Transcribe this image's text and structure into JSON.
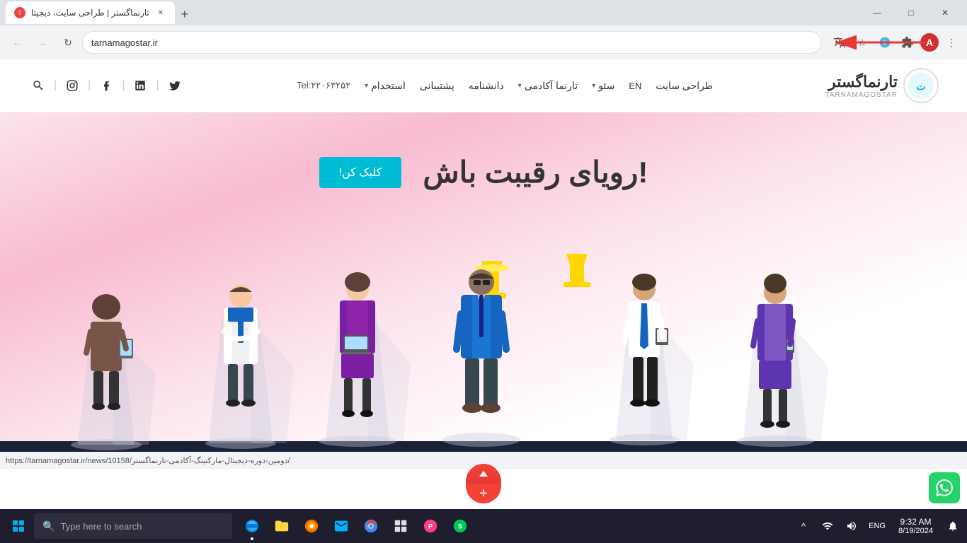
{
  "browser": {
    "tab": {
      "title": "تارنماگستر | طراحی سایت، دیجیتا",
      "favicon": "T"
    },
    "address": "tarnamagostar.ir",
    "new_tab_label": "+",
    "nav": {
      "back_disabled": true,
      "forward_disabled": true
    },
    "window_buttons": {
      "minimize": "—",
      "maximize": "□",
      "close": "✕"
    }
  },
  "site": {
    "logo": {
      "text_fa": "تارنماگستر",
      "text_en": "TARNAMAGOSTAR"
    },
    "nav_items": [
      {
        "label": "طراحی سایت",
        "has_dropdown": false
      },
      {
        "label": "EN",
        "has_dropdown": false
      },
      {
        "label": "سئو",
        "has_dropdown": true
      },
      {
        "label": "تارنما آکادمی",
        "has_dropdown": true
      },
      {
        "label": "دانشنامه",
        "has_dropdown": false
      },
      {
        "label": "پشتیبانی",
        "has_dropdown": false
      },
      {
        "label": "استخدام",
        "has_dropdown": true
      }
    ],
    "tel": "Tel:۲۲۰۶۳۲۵۲",
    "social_icons": [
      "twitter",
      "linkedin",
      "facebook",
      "instagram",
      "search"
    ],
    "hero": {
      "tagline": "!رویای رقیبت باش",
      "button_label": "کلیک کن!"
    }
  },
  "status_bar": {
    "url": "https://tarnamagostar.ir/news/10158/دومین-دوره-دیجیتال-مارکتینگ-آکادمی-تارنماگستر/"
  },
  "taskbar": {
    "search_placeholder": "Type here to search",
    "time": "9:32 AM",
    "date": "8/19/2024",
    "lang": "ENG",
    "icons": [
      {
        "name": "windows-start",
        "label": ""
      },
      {
        "name": "edge-browser",
        "label": "Edge"
      },
      {
        "name": "file-explorer",
        "label": "Files"
      },
      {
        "name": "firefox",
        "label": "Firefox"
      },
      {
        "name": "mail",
        "label": "Mail"
      },
      {
        "name": "chrome",
        "label": "Chrome"
      },
      {
        "name": "unknown1",
        "label": ""
      },
      {
        "name": "unknown2",
        "label": ""
      },
      {
        "name": "unknown3",
        "label": ""
      },
      {
        "name": "unknown4",
        "label": ""
      }
    ],
    "sys_tray": {
      "show_hidden": "^",
      "language": "ENG"
    },
    "notification_icon": "🔔"
  }
}
